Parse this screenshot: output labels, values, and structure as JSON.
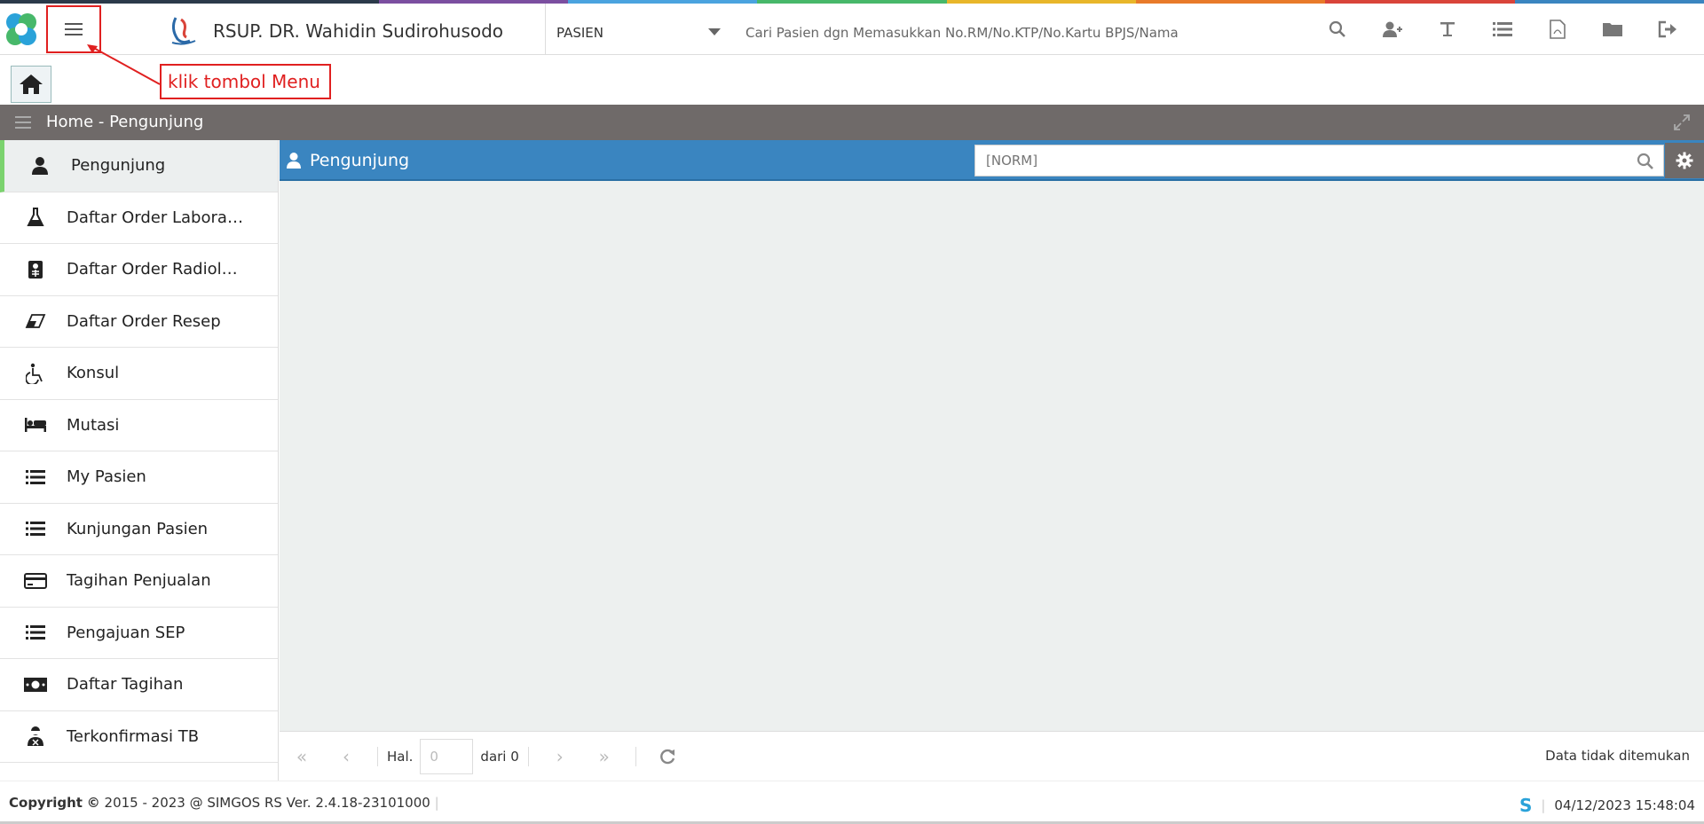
{
  "header": {
    "hospital_name": "RSUP. DR. Wahidin Sudirohusodo",
    "patient_select": "PASIEN",
    "search_placeholder": "Cari Pasien dgn Memasukkan No.RM/No.KTP/No.Kartu BPJS/Nama"
  },
  "annotation": {
    "text": "klik tombol Menu"
  },
  "breadcrumb": {
    "text": "Home - Pengunjung"
  },
  "sidebar": {
    "items": [
      {
        "label": "Pengunjung",
        "icon": "user-icon"
      },
      {
        "label": "Daftar Order Laborat...",
        "icon": "flask-icon"
      },
      {
        "label": "Daftar Order Radiologi",
        "icon": "xray-icon"
      },
      {
        "label": "Daftar Order Resep",
        "icon": "eraser-icon"
      },
      {
        "label": "Konsul",
        "icon": "wheelchair-icon"
      },
      {
        "label": "Mutasi",
        "icon": "bed-icon"
      },
      {
        "label": "My Pasien",
        "icon": "list-icon"
      },
      {
        "label": "Kunjungan Pasien",
        "icon": "list-icon"
      },
      {
        "label": "Tagihan Penjualan",
        "icon": "credit-card-icon"
      },
      {
        "label": "Pengajuan SEP",
        "icon": "list-icon"
      },
      {
        "label": "Daftar Tagihan",
        "icon": "money-icon"
      },
      {
        "label": "Terkonfirmasi TB",
        "icon": "person-mask-icon"
      }
    ]
  },
  "panel": {
    "title": "Pengunjung",
    "search_placeholder": "[NORM]"
  },
  "pager": {
    "page_label": "Hal.",
    "page_value": "0",
    "of_label": "dari 0",
    "status": "Data tidak ditemukan"
  },
  "footer": {
    "copyright_bold": "Copyright",
    "copyright_text": "2015 - 2023 @ SIMGOS RS Ver. 2.4.18-23101000",
    "datetime": "04/12/2023 15:48:04"
  },
  "colors": {
    "accent": "#3a85c0",
    "bar": "#6f6a69",
    "annotation": "#e02020",
    "active": "#7bd36e"
  }
}
